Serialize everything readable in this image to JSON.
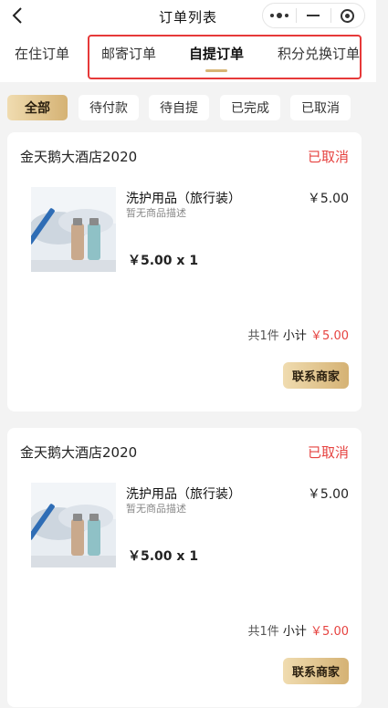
{
  "navbar": {
    "title": "订单列表",
    "back_icon": "chevron-left-icon",
    "capsule": {
      "more_icon": "more-dots-icon",
      "minimize_icon": "minus-icon",
      "close_icon": "target-circle-icon"
    }
  },
  "tabs": [
    {
      "label": "在住订单",
      "active": false
    },
    {
      "label": "邮寄订单",
      "active": false
    },
    {
      "label": "自提订单",
      "active": true
    },
    {
      "label": "积分兑换订单",
      "active": false
    }
  ],
  "filters": [
    {
      "label": "全部",
      "active": true
    },
    {
      "label": "待付款",
      "active": false
    },
    {
      "label": "待自提",
      "active": false
    },
    {
      "label": "已完成",
      "active": false
    },
    {
      "label": "已取消",
      "active": false
    }
  ],
  "orders": [
    {
      "store": "金天鹅大酒店2020",
      "status": "已取消",
      "product": {
        "name": "洗护用品（旅行装）",
        "desc": "暂无商品描述",
        "price": "￥5.00",
        "qty": "￥5.00 x 1"
      },
      "summary": {
        "count": "共1件",
        "label": "小计",
        "amount": "￥5.00"
      },
      "contact": "联系商家"
    },
    {
      "store": "金天鹅大酒店2020",
      "status": "已取消",
      "product": {
        "name": "洗护用品（旅行装）",
        "desc": "暂无商品描述",
        "price": "￥5.00",
        "qty": "￥5.00 x 1"
      },
      "summary": {
        "count": "共1件",
        "label": "小计",
        "amount": "￥5.00"
      },
      "contact": "联系商家"
    }
  ],
  "colors": {
    "accent_gold": "#d5b274",
    "status_red": "#e64340",
    "highlight_red": "#e63939",
    "background": "#f3f3f3"
  }
}
